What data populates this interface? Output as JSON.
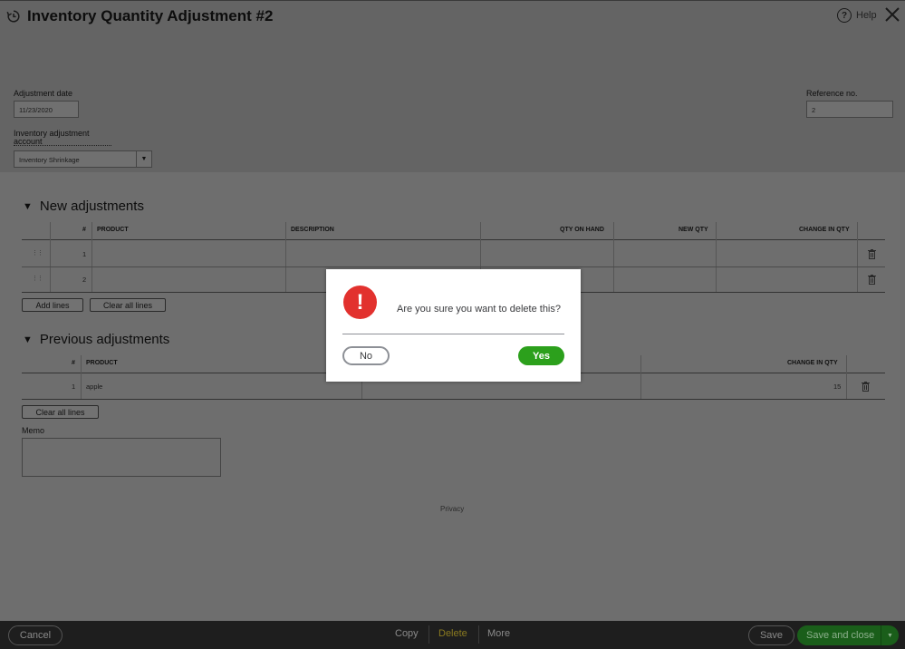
{
  "header": {
    "title": "Inventory Quantity Adjustment",
    "number": "#2",
    "help_label": "Help"
  },
  "form": {
    "adjustment_date_label": "Adjustment date",
    "adjustment_date_value": "11/23/2020",
    "reference_label": "Reference no.",
    "reference_value": "2",
    "account_label_line1": "Inventory adjustment",
    "account_label_line2": "account",
    "account_value": "Inventory Shrinkage"
  },
  "new_adjustments": {
    "title": "New adjustments",
    "columns": [
      "#",
      "PRODUCT",
      "DESCRIPTION",
      "QTY ON HAND",
      "NEW QTY",
      "CHANGE IN QTY"
    ],
    "rows": [
      {
        "num": "1",
        "product": "",
        "description": "",
        "qty_on_hand": "",
        "new_qty": "",
        "change": ""
      },
      {
        "num": "2",
        "product": "",
        "description": "",
        "qty_on_hand": "",
        "new_qty": "",
        "change": ""
      }
    ],
    "add_lines_label": "Add lines",
    "clear_lines_label": "Clear all lines"
  },
  "previous_adjustments": {
    "title": "Previous adjustments",
    "columns": [
      "#",
      "PRODUCT",
      "CHANGE IN QTY"
    ],
    "rows": [
      {
        "num": "1",
        "product": "apple",
        "change": "15"
      }
    ],
    "clear_lines_label": "Clear all lines"
  },
  "memo_label": "Memo",
  "privacy_label": "Privacy",
  "footer": {
    "cancel": "Cancel",
    "copy": "Copy",
    "delete": "Delete",
    "more": "More",
    "save": "Save",
    "save_close": "Save and close"
  },
  "dialog": {
    "message": "Are you sure you want to delete this?",
    "no_label": "No",
    "yes_label": "Yes",
    "icon_glyph": "!",
    "icon_color": "#e2312e",
    "yes_color": "#2ca01c"
  }
}
